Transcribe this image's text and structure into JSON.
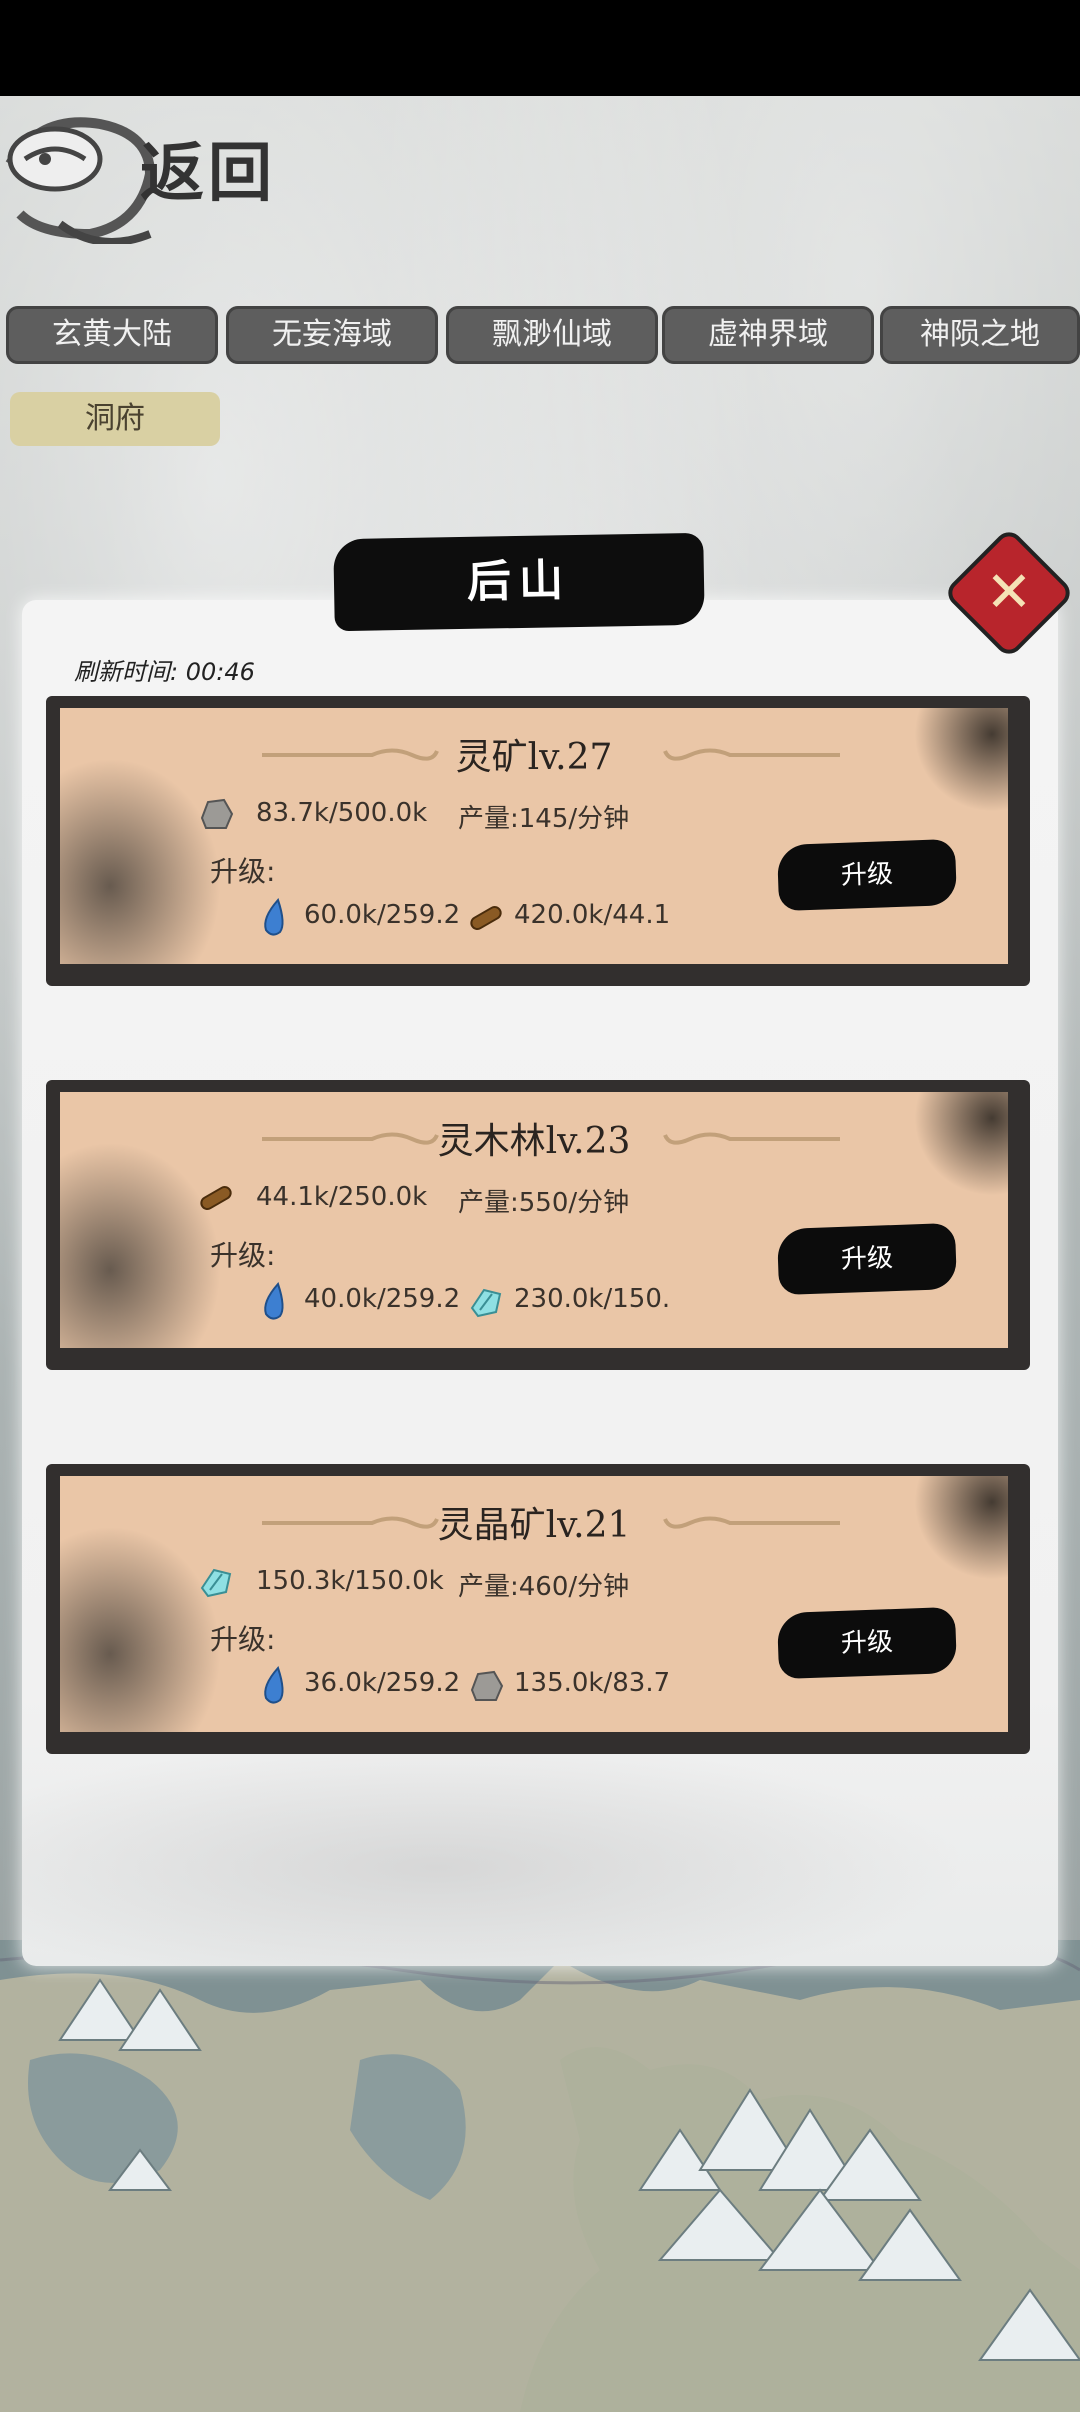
{
  "header": {
    "back_label": "返回"
  },
  "region_tabs": [
    "玄黄大陆",
    "无妄海域",
    "飘渺仙域",
    "虚神界域",
    "神陨之地"
  ],
  "sub_tab": "洞府",
  "panel": {
    "title": "后山",
    "refresh_label": "刷新时间: 00:46"
  },
  "buildings": [
    {
      "name": "灵矿lv.27",
      "stock_icon": "stone-icon",
      "stock": "83.7k/500.0k",
      "production": "产量:145/分钟",
      "upgrade_label": "升级:",
      "costs": [
        {
          "icon": "water-drop-icon",
          "value": "60.0k/259.2"
        },
        {
          "icon": "wood-log-icon",
          "value": "420.0k/44.1"
        }
      ],
      "button": "升级"
    },
    {
      "name": "灵木林lv.23",
      "stock_icon": "wood-log-icon",
      "stock": "44.1k/250.0k",
      "production": "产量:550/分钟",
      "upgrade_label": "升级:",
      "costs": [
        {
          "icon": "water-drop-icon",
          "value": "40.0k/259.2"
        },
        {
          "icon": "crystal-icon",
          "value": "230.0k/150."
        }
      ],
      "button": "升级"
    },
    {
      "name": "灵晶矿lv.21",
      "stock_icon": "crystal-icon",
      "stock": "150.3k/150.0k",
      "production": "产量:460/分钟",
      "upgrade_label": "升级:",
      "costs": [
        {
          "icon": "water-drop-icon",
          "value": "36.0k/259.2"
        },
        {
          "icon": "stone-icon",
          "value": "135.0k/83.7"
        }
      ],
      "button": "升级"
    }
  ],
  "colors": {
    "card_bg": "#eac6a7",
    "tab_bg": "#5e5e5e",
    "sub_tab_bg": "#d9d0a3",
    "close_red": "#b8252c"
  }
}
